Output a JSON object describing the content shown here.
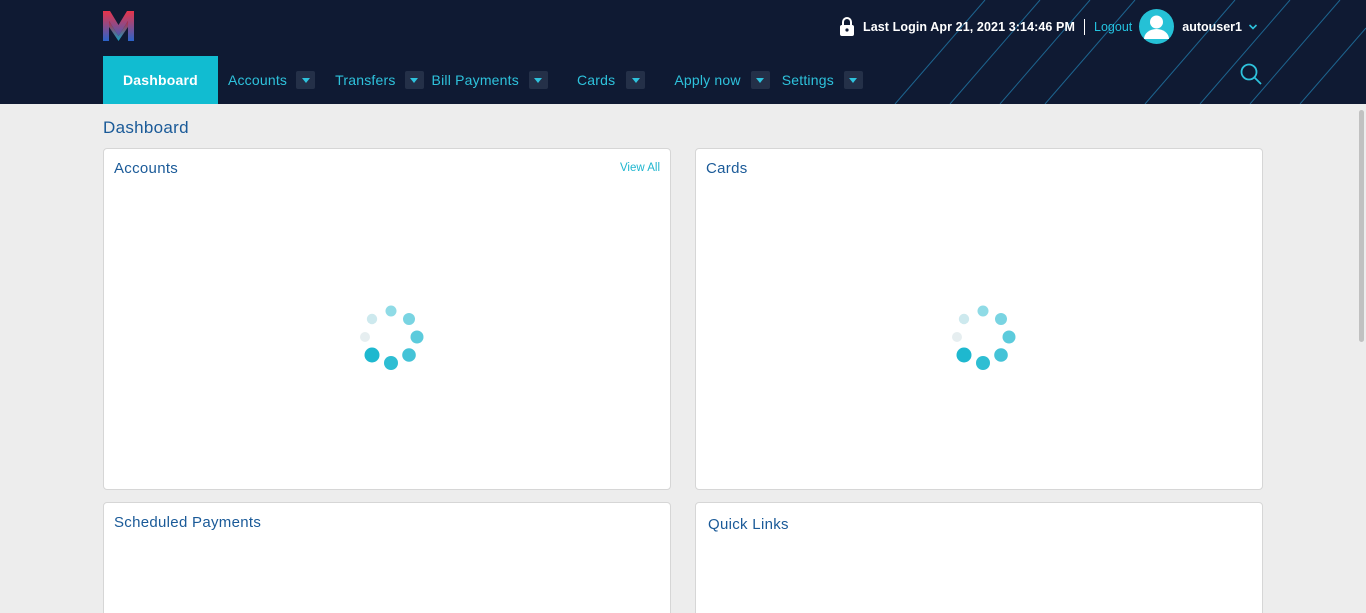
{
  "header": {
    "last_login": "Last Login Apr 21, 2021 3:14:46 PM",
    "logout_label": "Logout",
    "username": "autouser1"
  },
  "nav": {
    "items": [
      {
        "label": "Dashboard"
      },
      {
        "label": "Accounts"
      },
      {
        "label": "Transfers"
      },
      {
        "label": "Bill Payments"
      },
      {
        "label": "Cards"
      },
      {
        "label": "Apply now"
      },
      {
        "label": "Settings"
      }
    ]
  },
  "main": {
    "page_title": "Dashboard",
    "panels": {
      "accounts": {
        "title": "Accounts",
        "view_all": "View All"
      },
      "cards": {
        "title": "Cards"
      },
      "scheduled": {
        "title": "Scheduled Payments"
      },
      "quick_links": {
        "title": "Quick Links"
      }
    }
  },
  "colors": {
    "header_bg": "#0f1a33",
    "accent": "#11bcd1",
    "title_blue": "#1a5a98",
    "page_bg": "#ededed"
  }
}
